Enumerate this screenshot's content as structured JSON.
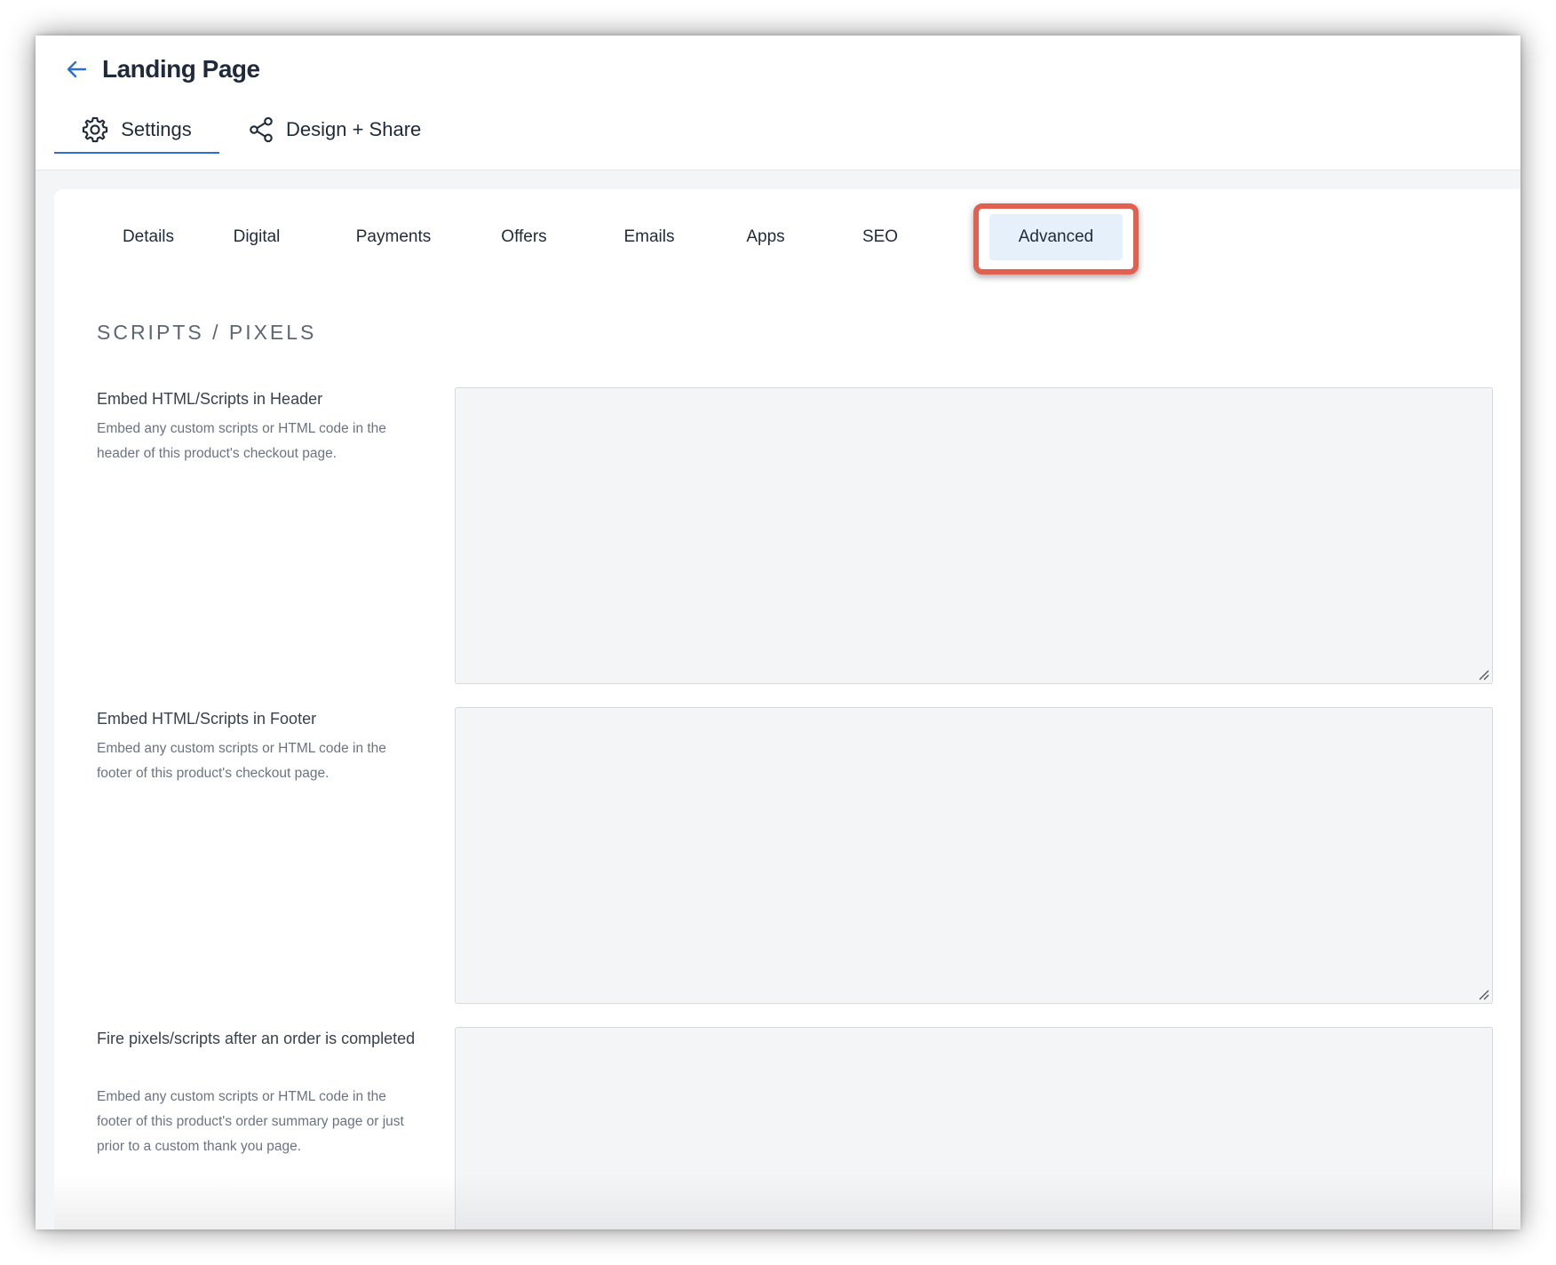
{
  "header": {
    "back_icon": "arrow-left-icon",
    "title": "Landing Page"
  },
  "main_tabs": [
    {
      "label": "Settings",
      "icon": "gear-icon",
      "active": true
    },
    {
      "label": "Design + Share",
      "icon": "share-icon",
      "active": false
    }
  ],
  "sub_tabs": [
    {
      "label": "Details",
      "active": false
    },
    {
      "label": "Digital",
      "active": false
    },
    {
      "label": "Payments",
      "active": false
    },
    {
      "label": "Offers",
      "active": false
    },
    {
      "label": "Emails",
      "active": false
    },
    {
      "label": "Apps",
      "active": false
    },
    {
      "label": "SEO",
      "active": false
    },
    {
      "label": "Advanced",
      "active": true
    }
  ],
  "section": {
    "title": "SCRIPTS / PIXELS"
  },
  "fields": [
    {
      "label": "Embed HTML/Scripts in Header",
      "help": "Embed any custom scripts or HTML code in the header of this product's checkout page.",
      "value": ""
    },
    {
      "label": "Embed HTML/Scripts in Footer",
      "help": "Embed any custom scripts or HTML code in the footer of this product's checkout page.",
      "value": ""
    },
    {
      "label": "Fire pixels/scripts after an order is completed",
      "help": "Embed any custom scripts or HTML code in the footer of this product's order summary page or just prior to a custom thank you page.",
      "value": ""
    }
  ],
  "colors": {
    "accent": "#2b6fd6",
    "active_tab_bg": "#e6f0fb",
    "highlight": "#e2604f"
  }
}
